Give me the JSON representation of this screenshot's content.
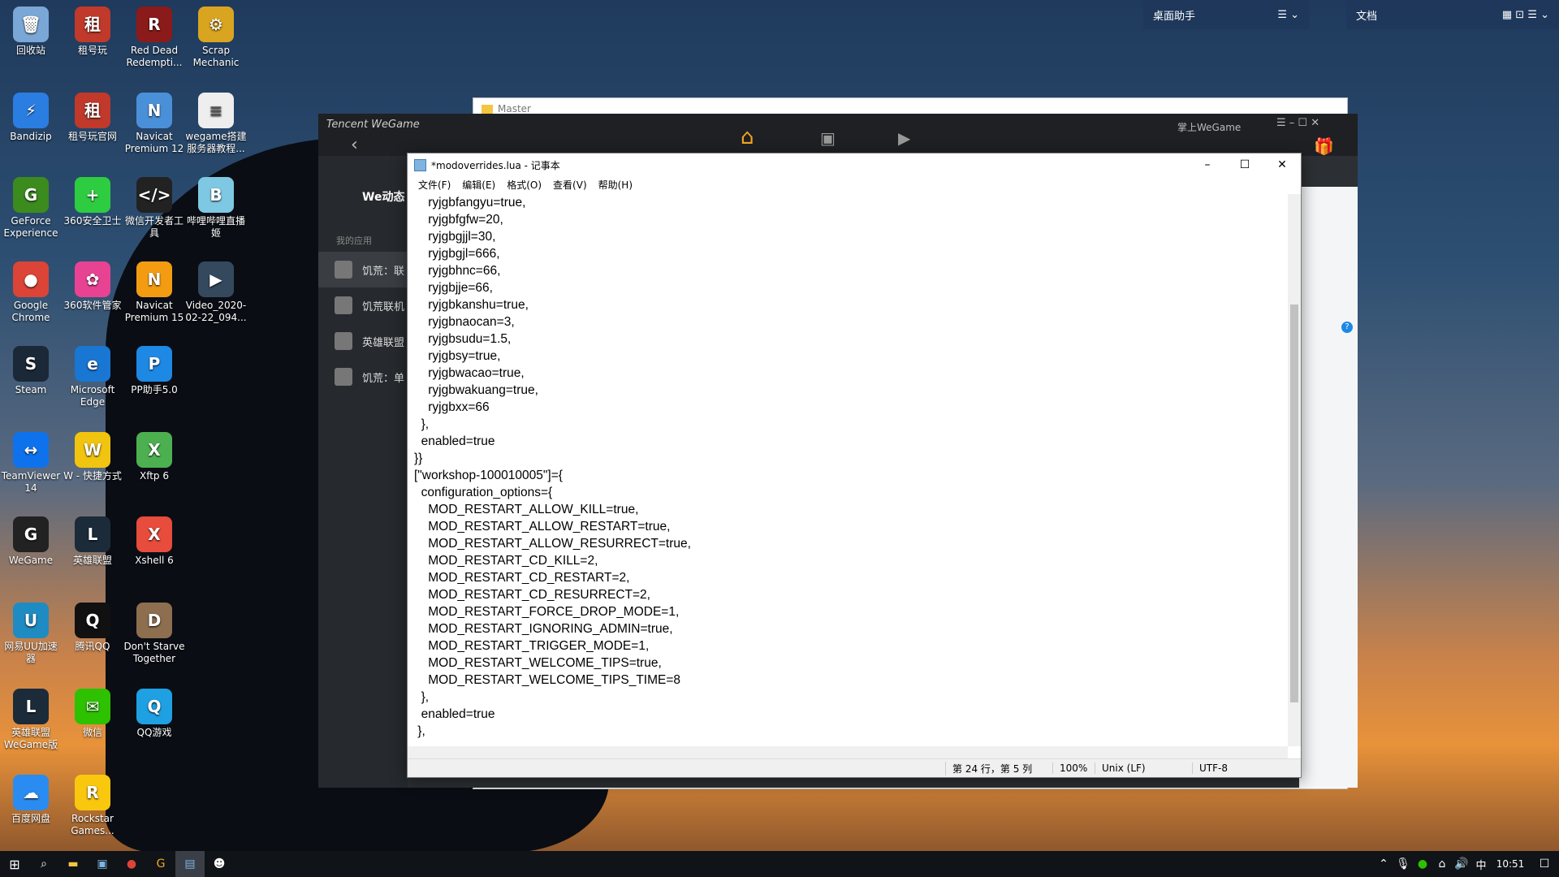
{
  "desktop_icons": [
    {
      "label": "回收站",
      "icon": "recycle-bin-icon",
      "color": "#7aa7d6",
      "glyph": "🗑"
    },
    {
      "label": "租号玩",
      "icon": "zuhaowan-icon",
      "color": "#c0392b",
      "glyph": "租"
    },
    {
      "label": "Red Dead Redempti...",
      "icon": "red-dead-icon",
      "color": "#8b1a1a",
      "glyph": "R"
    },
    {
      "label": "Scrap Mechanic",
      "icon": "scrap-mechanic-icon",
      "color": "#d9a520",
      "glyph": "⚙"
    },
    {
      "label": "Bandizip",
      "icon": "bandizip-icon",
      "color": "#2a7de1",
      "glyph": "⚡"
    },
    {
      "label": "租号玩官网",
      "icon": "zuhaowan-site-icon",
      "color": "#c0392b",
      "glyph": "租"
    },
    {
      "label": "Navicat Premium 12",
      "icon": "navicat-icon",
      "color": "#4a90d9",
      "glyph": "N"
    },
    {
      "label": "wegame搭建服务器教程...",
      "icon": "document-icon",
      "color": "#eeeeee",
      "glyph": "≡"
    },
    {
      "label": "GeForce Experience",
      "icon": "geforce-icon",
      "color": "#3c8b1e",
      "glyph": "G"
    },
    {
      "label": "360安全卫士",
      "icon": "360-safe-icon",
      "color": "#2ecc40",
      "glyph": "+"
    },
    {
      "label": "微信开发者工具",
      "icon": "wechat-dev-icon",
      "color": "#222222",
      "glyph": "</>"
    },
    {
      "label": "哔哩哔哩直播姬",
      "icon": "bilibili-icon",
      "color": "#7ec8e3",
      "glyph": "B"
    },
    {
      "label": "Google Chrome",
      "icon": "chrome-icon",
      "color": "#db4437",
      "glyph": "●"
    },
    {
      "label": "360软件管家",
      "icon": "360-soft-icon",
      "color": "#e84393",
      "glyph": "✿"
    },
    {
      "label": "Navicat Premium 15",
      "icon": "navicat15-icon",
      "color": "#f39c12",
      "glyph": "N"
    },
    {
      "label": "Video_2020-02-22_094...",
      "icon": "video-icon",
      "color": "#34495e",
      "glyph": "▶"
    },
    {
      "label": "Steam",
      "icon": "steam-icon",
      "color": "#1b2838",
      "glyph": "S"
    },
    {
      "label": "Microsoft Edge",
      "icon": "edge-icon",
      "color": "#1976d2",
      "glyph": "e"
    },
    {
      "label": "PP助手5.0",
      "icon": "pp-icon",
      "color": "#1e88e5",
      "glyph": "P"
    },
    {
      "label": "TeamViewer 14",
      "icon": "teamviewer-icon",
      "color": "#0e72ed",
      "glyph": "↔"
    },
    {
      "label": "W - 快捷方式",
      "icon": "shortcut-icon",
      "color": "#f1c40f",
      "glyph": "W"
    },
    {
      "label": "Xftp 6",
      "icon": "xftp-icon",
      "color": "#4caf50",
      "glyph": "X"
    },
    {
      "label": "WeGame",
      "icon": "wegame-icon",
      "color": "#222222",
      "glyph": "G"
    },
    {
      "label": "英雄联盟",
      "icon": "lol-icon",
      "color": "#1c2b3a",
      "glyph": "L"
    },
    {
      "label": "Xshell 6",
      "icon": "xshell-icon",
      "color": "#e74c3c",
      "glyph": "X"
    },
    {
      "label": "网易UU加速器",
      "icon": "uu-icon",
      "color": "#1e8bc3",
      "glyph": "U"
    },
    {
      "label": "腾讯QQ",
      "icon": "qq-icon",
      "color": "#111111",
      "glyph": "Q"
    },
    {
      "label": "Don't Starve Together",
      "icon": "dst-icon",
      "color": "#8d6e4f",
      "glyph": "D"
    },
    {
      "label": "英雄联盟WeGame版",
      "icon": "lol-wegame-icon",
      "color": "#1c2b3a",
      "glyph": "L"
    },
    {
      "label": "微信",
      "icon": "wechat-icon",
      "color": "#2dc100",
      "glyph": "✉"
    },
    {
      "label": "QQ游戏",
      "icon": "qq-game-icon",
      "color": "#1ea0e3",
      "glyph": "Q"
    },
    {
      "label": "百度网盘",
      "icon": "baidu-pan-icon",
      "color": "#2a8cf0",
      "glyph": "☁"
    },
    {
      "label": "Rockstar Games...",
      "icon": "rockstar-icon",
      "color": "#f9c80e",
      "glyph": "R"
    }
  ],
  "widgets": {
    "left_title": "桌面助手",
    "right_title": "文档"
  },
  "explorer": {
    "title": "Master"
  },
  "wegame": {
    "brand": "Tencent WeGame",
    "account": "掌上WeGame",
    "section": "我的应用",
    "panel_title": "We动态",
    "apps": [
      "饥荒：联",
      "饥荒联机",
      "英雄联盟",
      "饥荒：单"
    ]
  },
  "notepad": {
    "title": "*modoverrides.lua - 记事本",
    "menu": [
      "文件(F)",
      "编辑(E)",
      "格式(O)",
      "查看(V)",
      "帮助(H)"
    ],
    "lines": [
      "    ryjgbfangyu=true,",
      "    ryjgbfgfw=20,",
      "    ryjgbgjjl=30,",
      "    ryjgbgjl=666,",
      "    ryjgbhnc=66,",
      "    ryjgbjje=66,",
      "    ryjgbkanshu=true,",
      "    ryjgbnaocan=3,",
      "    ryjgbsudu=1.5,",
      "    ryjgbsy=true,",
      "    ryjgbwacao=true,",
      "    ryjgbwakuang=true,",
      "    ryjgbxx=66",
      "  },",
      "  enabled=true",
      "}}",
      "[\"workshop-100010005\"]={",
      "  configuration_options={",
      "    MOD_RESTART_ALLOW_KILL=true,",
      "    MOD_RESTART_ALLOW_RESTART=true,",
      "    MOD_RESTART_ALLOW_RESURRECT=true,",
      "    MOD_RESTART_CD_KILL=2,",
      "    MOD_RESTART_CD_RESTART=2,",
      "    MOD_RESTART_CD_RESURRECT=2,",
      "    MOD_RESTART_FORCE_DROP_MODE=1,",
      "    MOD_RESTART_IGNORING_ADMIN=true,",
      "    MOD_RESTART_TRIGGER_MODE=1,",
      "    MOD_RESTART_WELCOME_TIPS=true,",
      "    MOD_RESTART_WELCOME_TIPS_TIME=8",
      "  },",
      "  enabled=true",
      " },"
    ],
    "status": {
      "position": "第 24 行，第 5 列",
      "zoom": "100%",
      "line_ending": "Unix (LF)",
      "encoding": "UTF-8"
    }
  },
  "taskbar": {
    "clock": "10:51",
    "ime": "中"
  }
}
